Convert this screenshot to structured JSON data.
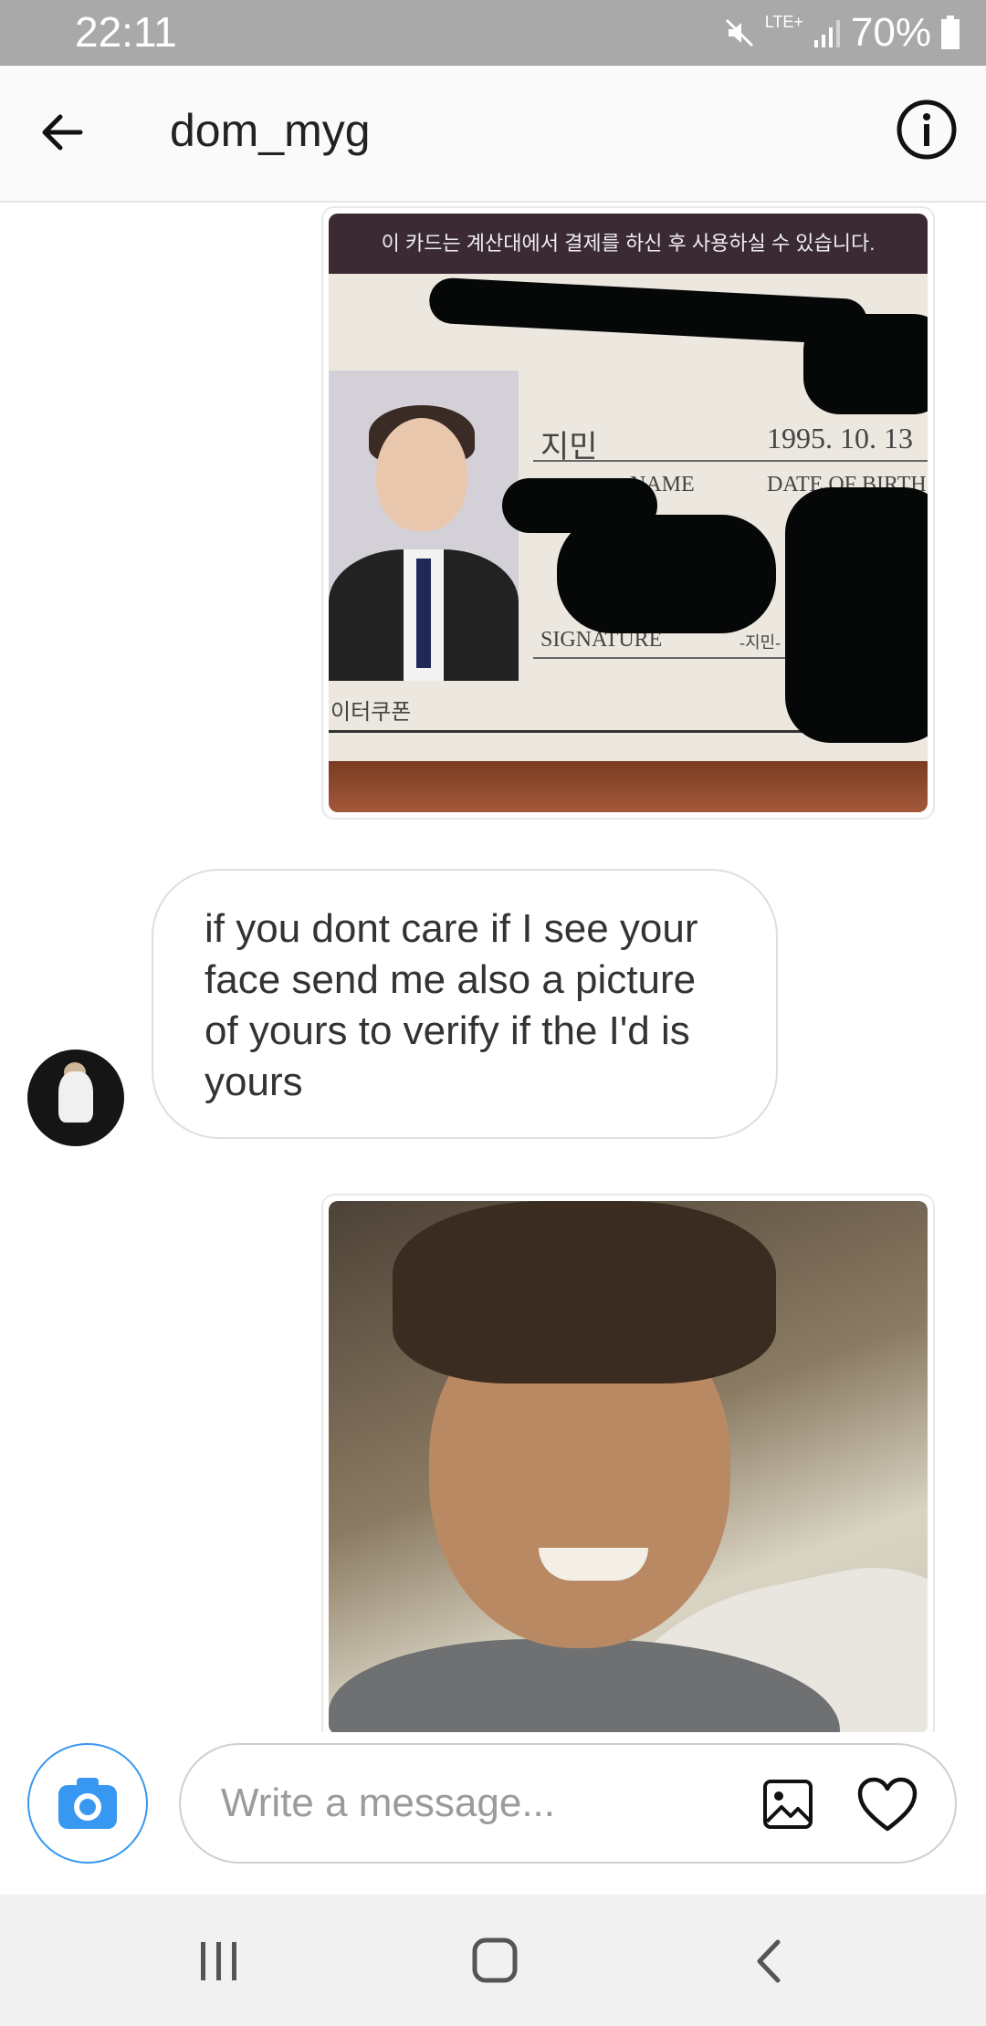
{
  "status_bar": {
    "time": "22:11",
    "network": "LTE+",
    "battery": "70%"
  },
  "header": {
    "title": "dom_myg"
  },
  "messages": {
    "id_card": {
      "top_text": "이 카드는 계산대에서 결제를 하신 후 사용하실 수 있습니다.",
      "name_korean": "지민",
      "birthdate": "1995. 10. 13",
      "name_label": "NAME",
      "dob_label": "DATE OF BIRTH",
      "signature_label": "SIGNATURE",
      "signature_value": "-지민-",
      "issuer": "이터쿠폰"
    },
    "received_text": "if you dont care if I see your face send me also a picture of yours to verify if the I'd is yours"
  },
  "composer": {
    "placeholder": "Write a message..."
  },
  "colors": {
    "accent": "#3897f0",
    "status_bar": "#a9a9a9"
  },
  "icons": {
    "back": "arrow-left-icon",
    "info": "info-icon",
    "camera": "camera-icon",
    "gallery": "gallery-icon",
    "heart": "heart-icon"
  }
}
